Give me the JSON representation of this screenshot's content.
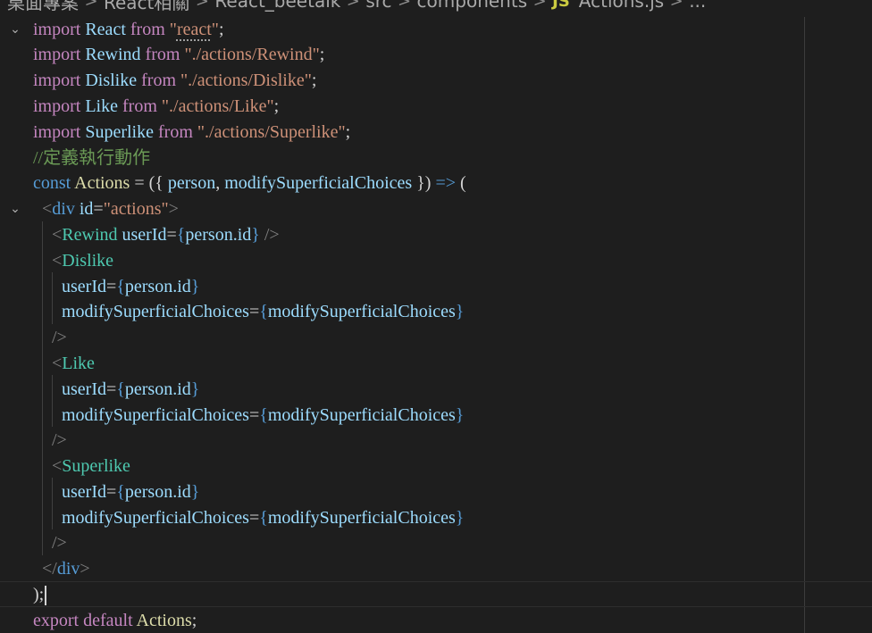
{
  "breadcrumb": {
    "items": [
      "桌面專案",
      "React相關",
      "React_beetalk",
      "src",
      "components"
    ],
    "separator": ">",
    "file_badge": "JS",
    "file": "Actions.js",
    "ellipsis": "..."
  },
  "code": {
    "l1": {
      "kw": "import",
      "name": "React",
      "from": "from",
      "q1": "\"",
      "str": "react",
      "q2": "\"",
      "semi": ";"
    },
    "l2": {
      "kw": "import",
      "name": "Rewind",
      "from": "from",
      "str": "\"./actions/Rewind\"",
      "semi": ";"
    },
    "l3": {
      "kw": "import",
      "name": "Dislike",
      "from": "from",
      "str": "\"./actions/Dislike\"",
      "semi": ";"
    },
    "l4": {
      "kw": "import",
      "name": "Like",
      "from": "from",
      "str": "\"./actions/Like\"",
      "semi": ";"
    },
    "l5": {
      "kw": "import",
      "name": "Superlike",
      "from": "from",
      "str": "\"./actions/Superlike\"",
      "semi": ";"
    },
    "l6": {
      "comment": "//定義執行動作"
    },
    "l7": {
      "kw": "const",
      "name": "Actions",
      "eq": " = ({ ",
      "p1": "person",
      "comma": ", ",
      "p2": "modifySuperficialChoices",
      "close": " }) ",
      "arrow": "=>",
      "paren": " ("
    },
    "l8": {
      "open": "<",
      "tag": "div",
      "attr": "id",
      "eq": "=",
      "val": "\"actions\"",
      "close": ">"
    },
    "l9": {
      "open": "<",
      "tag": "Rewind",
      "attr": "userId",
      "eq": "=",
      "bo": "{",
      "val": "person.id",
      "bc": "}",
      "close": " />"
    },
    "l10": {
      "open": "<",
      "tag": "Dislike"
    },
    "l11": {
      "attr": "userId",
      "eq": "=",
      "bo": "{",
      "val": "person.id",
      "bc": "}"
    },
    "l12": {
      "attr": "modifySuperficialChoices",
      "eq": "=",
      "bo": "{",
      "val": "modifySuperficialChoices",
      "bc": "}"
    },
    "l13": {
      "close": "/>"
    },
    "l14": {
      "open": "<",
      "tag": "Like"
    },
    "l15": {
      "attr": "userId",
      "eq": "=",
      "bo": "{",
      "val": "person.id",
      "bc": "}"
    },
    "l16": {
      "attr": "modifySuperficialChoices",
      "eq": "=",
      "bo": "{",
      "val": "modifySuperficialChoices",
      "bc": "}"
    },
    "l17": {
      "close": "/>"
    },
    "l18": {
      "open": "<",
      "tag": "Superlike"
    },
    "l19": {
      "attr": "userId",
      "eq": "=",
      "bo": "{",
      "val": "person.id",
      "bc": "}"
    },
    "l20": {
      "attr": "modifySuperficialChoices",
      "eq": "=",
      "bo": "{",
      "val": "modifySuperficialChoices",
      "bc": "}"
    },
    "l21": {
      "close": "/>"
    },
    "l22": {
      "open": "</",
      "tag": "div",
      "close": ">"
    },
    "l23": {
      "text": ");"
    },
    "l24": {
      "kw1": "export",
      "kw2": "default",
      "name": "Actions",
      "semi": ";"
    }
  },
  "icons": {
    "fold": "chevron-down-icon",
    "file": "javascript-file-icon"
  },
  "colors": {
    "background": "#1e1e1e",
    "keyword_import": "#c586c0",
    "keyword_decl": "#569cd6",
    "identifier": "#9cdcfe",
    "string": "#ce9178",
    "comment": "#6a9955",
    "function": "#dcdcaa",
    "component_tag": "#4ec9b0",
    "tag_bracket": "#808080"
  }
}
